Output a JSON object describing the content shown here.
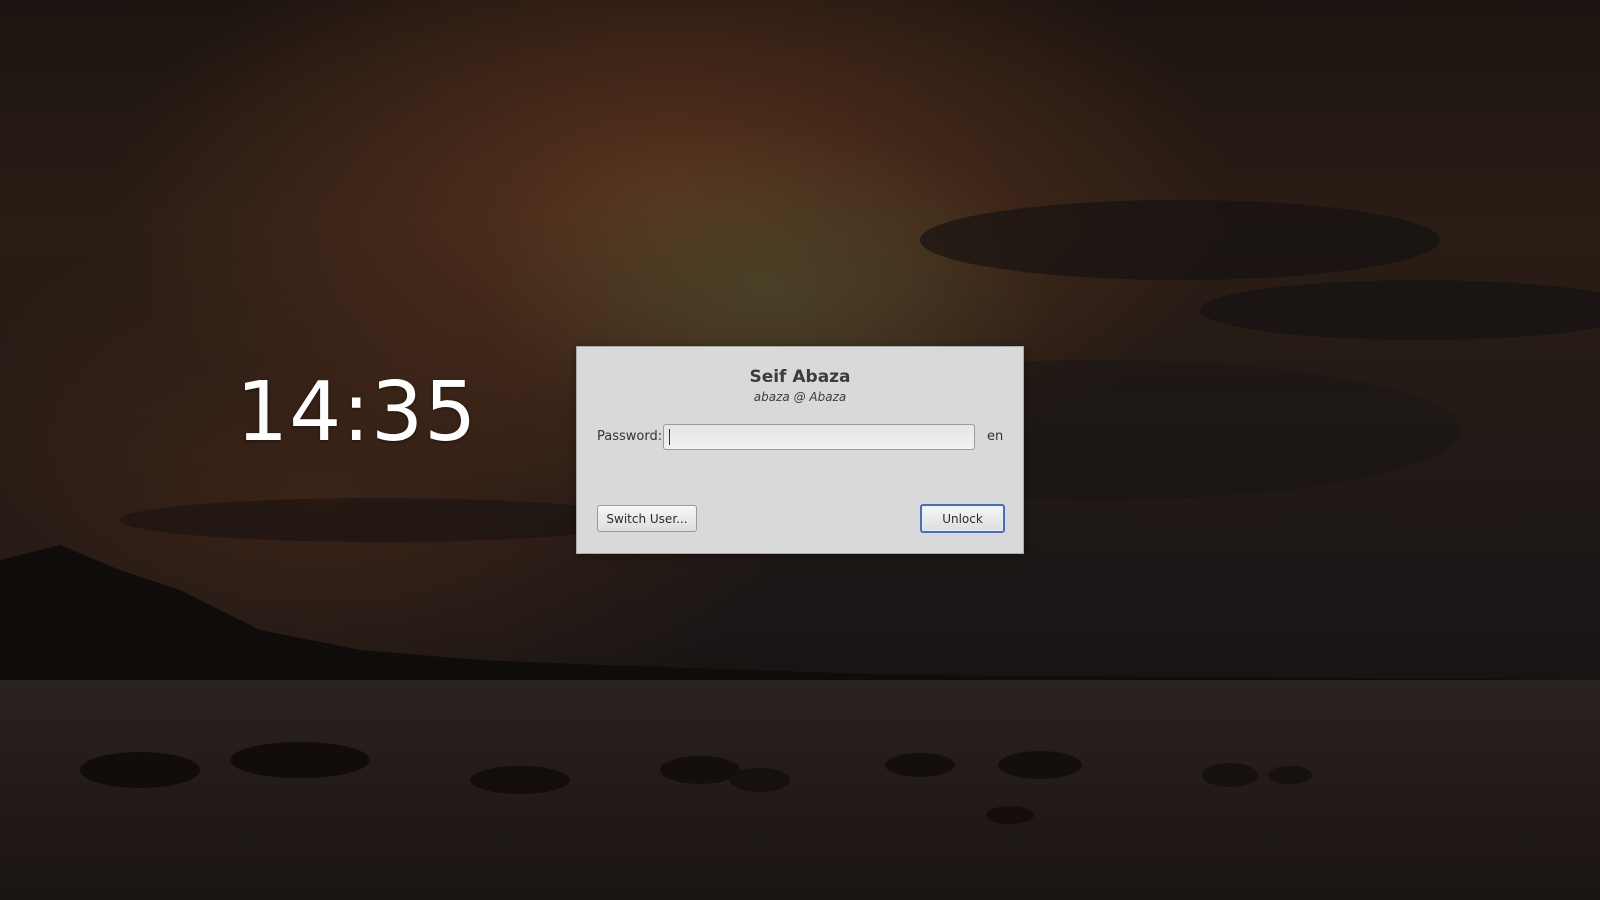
{
  "clock": {
    "time": "14:35"
  },
  "dialog": {
    "user_full_name": "Seif Abaza",
    "user_host": "abaza @ Abaza",
    "password_label": "Password:",
    "password_value": "",
    "keyboard_layout": "en",
    "switch_user_label": "Switch User...",
    "unlock_label": "Unlock"
  },
  "colors": {
    "dialog_background": "#d9d9d9",
    "default_button_border": "#4a6db3",
    "clock_text": "#ffffff"
  }
}
